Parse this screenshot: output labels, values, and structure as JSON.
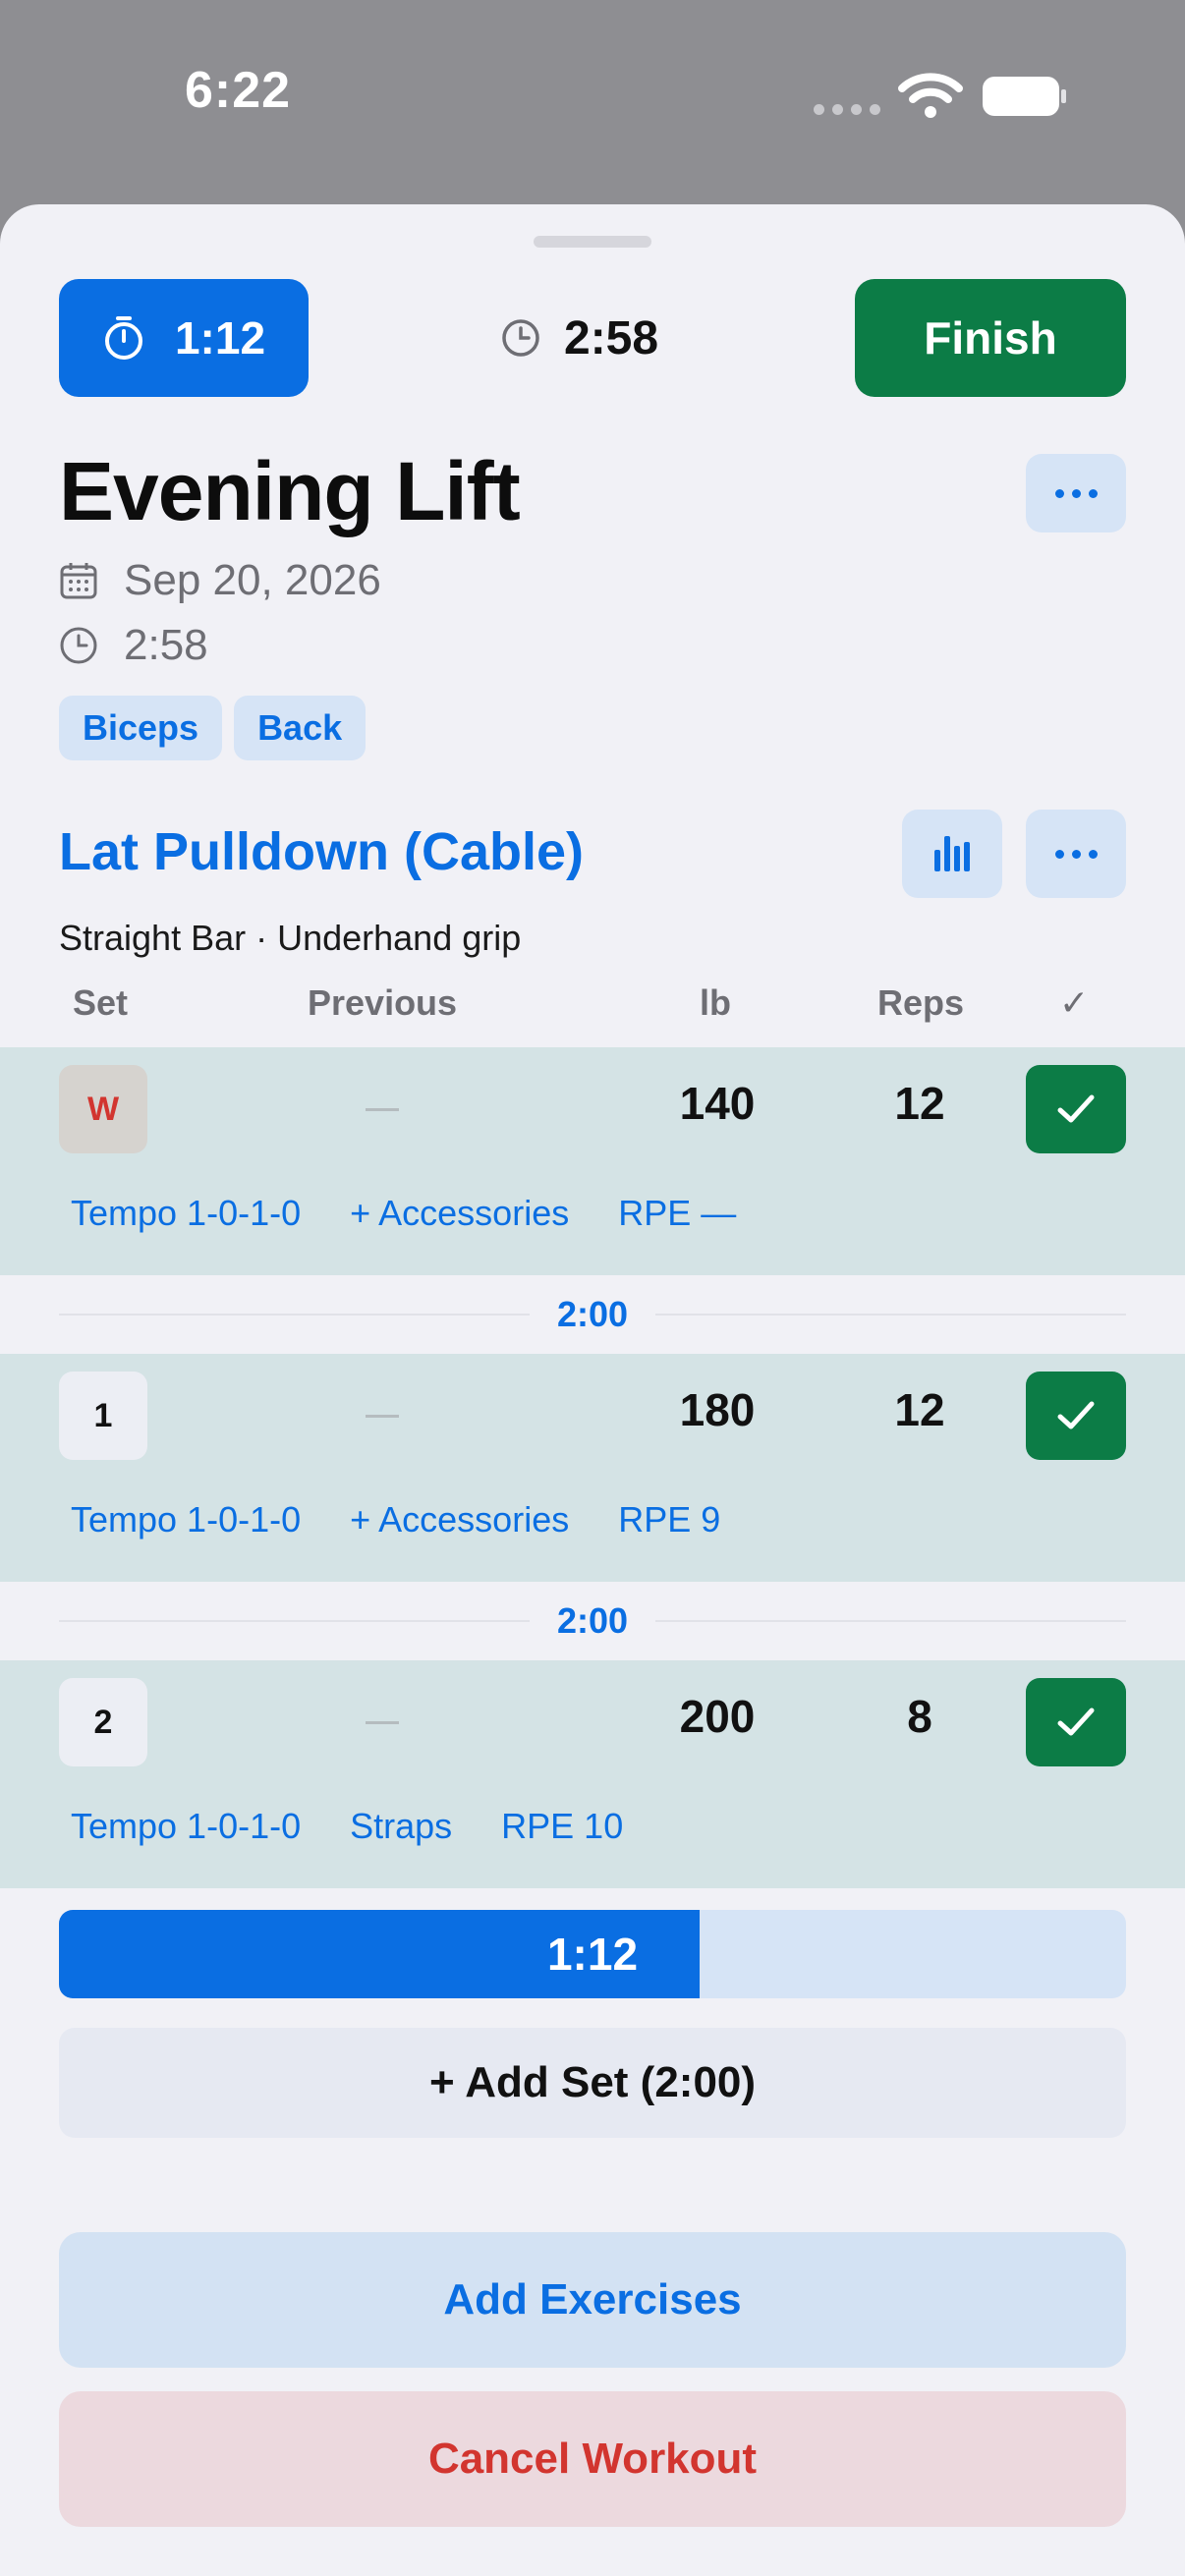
{
  "status_bar": {
    "time": "6:22"
  },
  "header": {
    "rest_timer": "1:12",
    "elapsed": "2:58",
    "finish_label": "Finish"
  },
  "workout": {
    "title": "Evening Lift",
    "date": "Sep 20, 2026",
    "duration": "2:58",
    "tags": [
      "Biceps",
      "Back"
    ]
  },
  "exercise": {
    "name": "Lat Pulldown (Cable)",
    "subtitle": "Straight Bar · Underhand grip",
    "columns": {
      "set": "Set",
      "previous": "Previous",
      "weight": "lb",
      "reps": "Reps",
      "done": "✓"
    },
    "sets": [
      {
        "label": "W",
        "previous": "—",
        "weight": "140",
        "reps": "12",
        "completed": true,
        "tempo": "Tempo 1-0-1-0",
        "accessory": "+ Accessories",
        "rpe": "RPE —"
      },
      {
        "label": "1",
        "previous": "—",
        "weight": "180",
        "reps": "12",
        "completed": true,
        "tempo": "Tempo 1-0-1-0",
        "accessory": "+ Accessories",
        "rpe": "RPE 9"
      },
      {
        "label": "2",
        "previous": "—",
        "weight": "200",
        "reps": "8",
        "completed": true,
        "tempo": "Tempo 1-0-1-0",
        "accessory": "Straps",
        "rpe": "RPE 10"
      }
    ],
    "rest_intervals": [
      "2:00",
      "2:00"
    ],
    "rest_progress": {
      "label": "1:12",
      "fraction": 0.6
    },
    "add_set_label": "+ Add Set (2:00)"
  },
  "actions": {
    "add_exercises": "Add Exercises",
    "cancel_workout": "Cancel Workout"
  },
  "colors": {
    "accent": "#0a6ee2",
    "finish": "#0c7c46",
    "danger": "#d2352f",
    "completed_row": "#d4e3e5"
  },
  "icons": [
    "stopwatch-icon",
    "clock-icon",
    "calendar-icon",
    "bar-chart-icon",
    "more-icon",
    "checkmark-icon",
    "wifi-icon",
    "battery-icon"
  ]
}
